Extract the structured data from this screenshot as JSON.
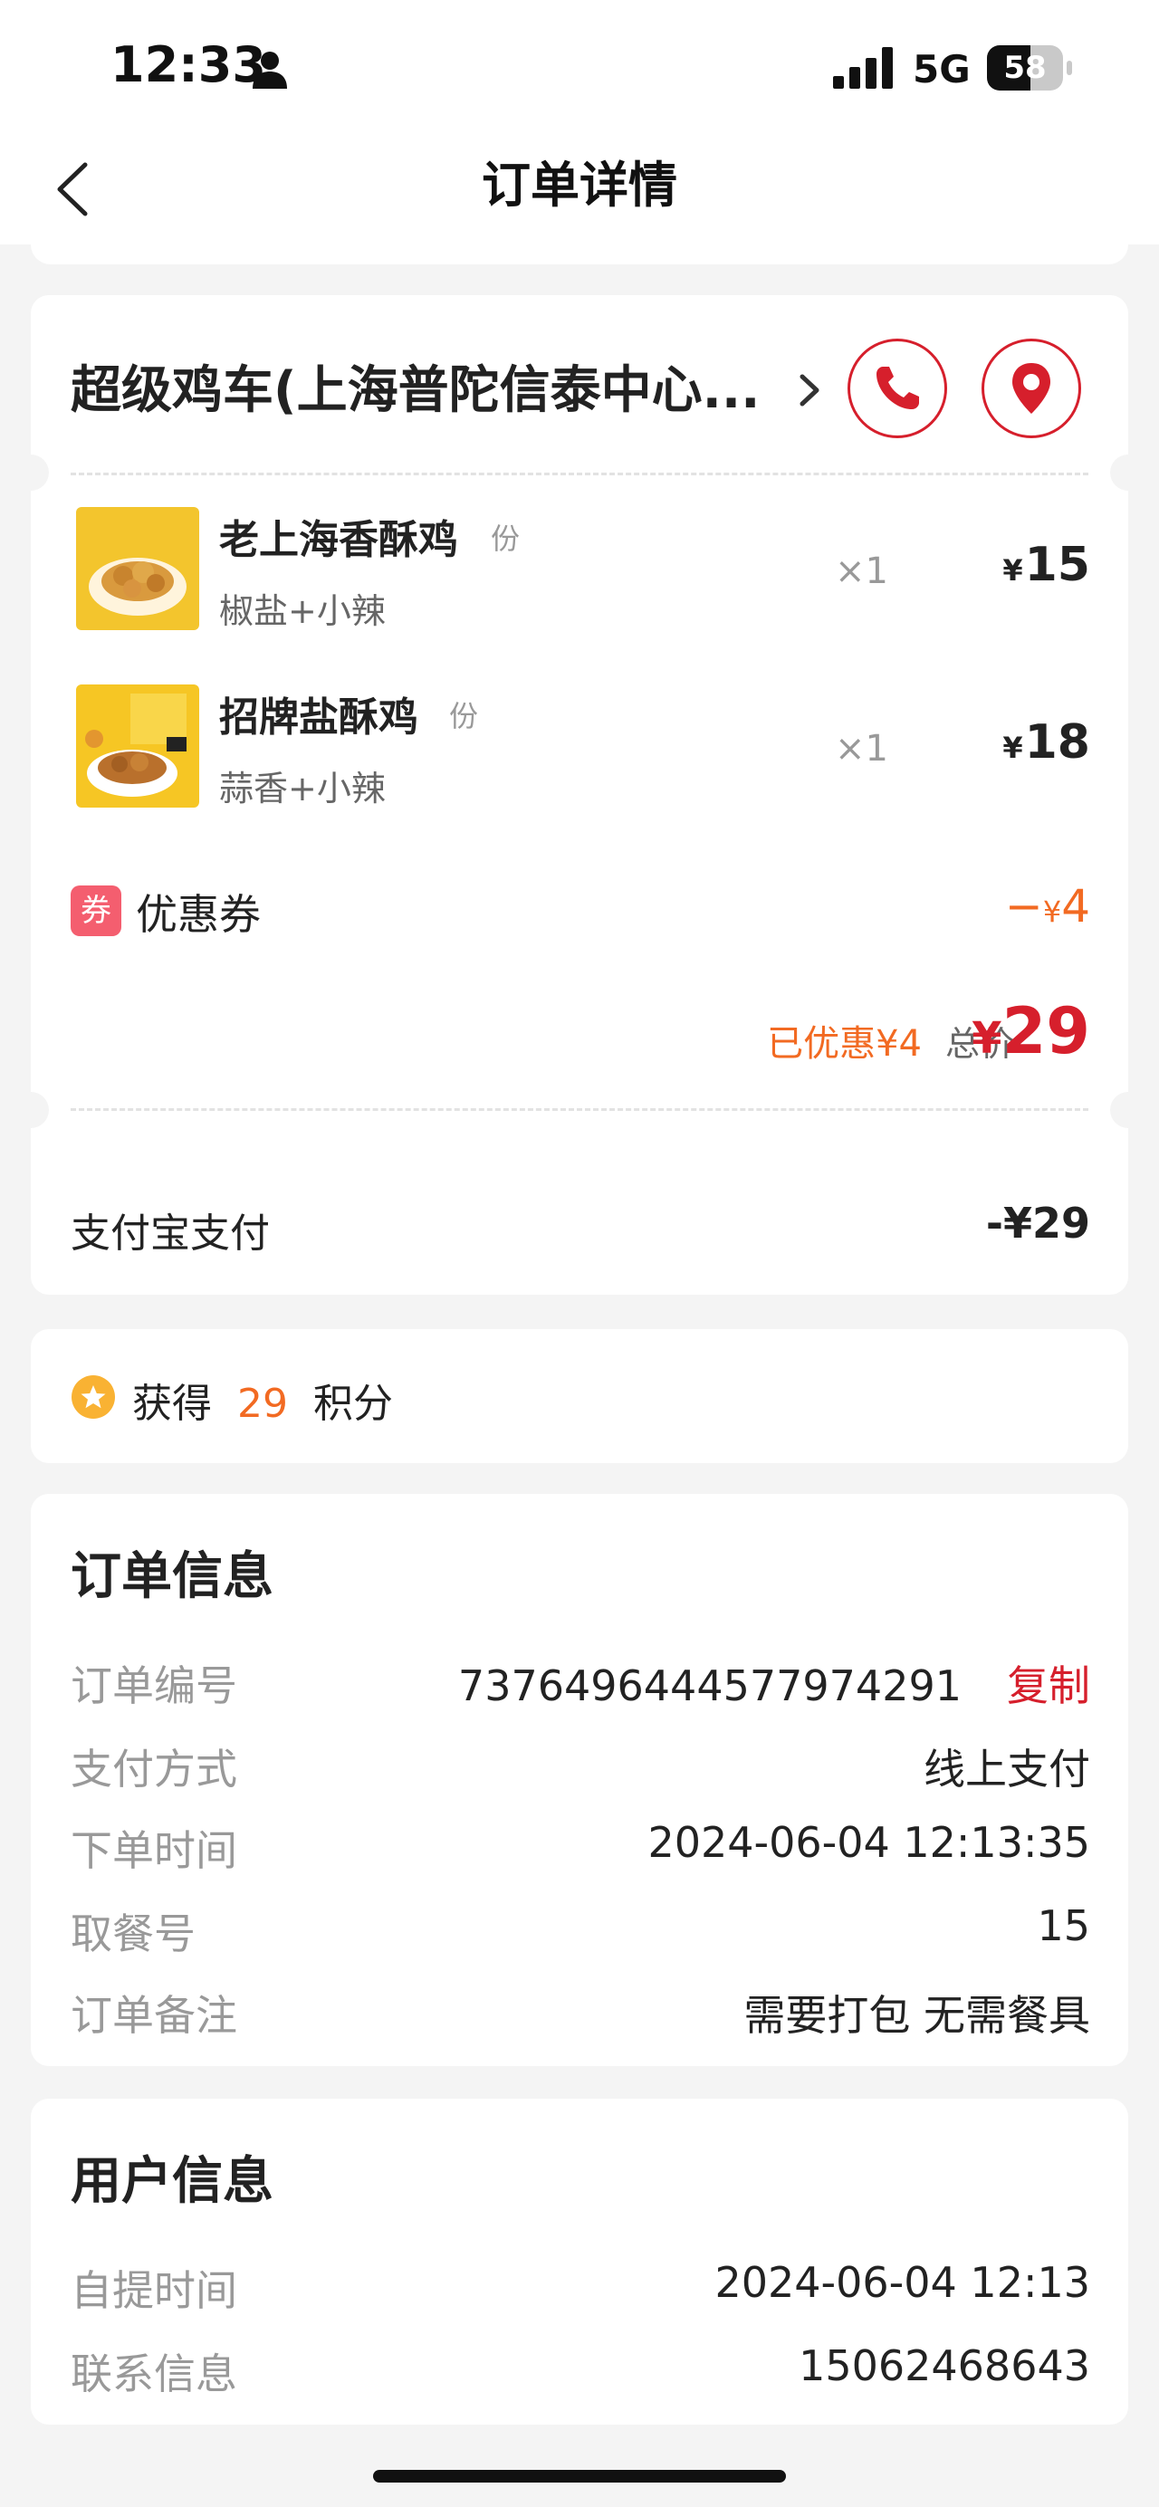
{
  "status_bar": {
    "time": "12:33",
    "network": "5G",
    "battery": "58"
  },
  "nav": {
    "title": "订单详情"
  },
  "store": {
    "name": "超级鸡车(上海普陀信泰中心..."
  },
  "items": [
    {
      "name": "老上海香酥鸡",
      "unit": "份",
      "spec": "椒盐+小辣",
      "qty": "×1",
      "currency": "¥",
      "price": "15"
    },
    {
      "name": "招牌盐酥鸡",
      "unit": "份",
      "spec": "蒜香+小辣",
      "qty": "×1",
      "currency": "¥",
      "price": "18"
    }
  ],
  "coupon": {
    "badge": "券",
    "label": "优惠券",
    "amount_prefix": "−",
    "currency": "¥",
    "amount": "4"
  },
  "summary": {
    "discount_text": "已优惠¥4",
    "total_label": "总价",
    "currency": "¥",
    "total": "29"
  },
  "payment": {
    "method": "支付宝支付",
    "amount": "-¥29"
  },
  "points": {
    "prefix": "获得  ",
    "value": "29",
    "suffix": "  积分"
  },
  "order_info": {
    "title": "订单信息",
    "rows": [
      {
        "label": "订单编号",
        "value": "7376496444577974291",
        "action": "复制"
      },
      {
        "label": "支付方式",
        "value": "线上支付"
      },
      {
        "label": "下单时间",
        "value": "2024-06-04 12:13:35"
      },
      {
        "label": "取餐号",
        "value": "15"
      },
      {
        "label": "订单备注",
        "value": "需要打包 无需餐具"
      }
    ]
  },
  "user_info": {
    "title": "用户信息",
    "rows": [
      {
        "label": "自提时间",
        "value": "2024-06-04 12:13"
      },
      {
        "label": "联系信息",
        "value": "15062468643"
      }
    ]
  },
  "colors": {
    "accent_red": "#d61f2c",
    "accent_orange": "#f26a22",
    "coupon_pink": "#f45e6f",
    "background": "#f4f4f4"
  }
}
